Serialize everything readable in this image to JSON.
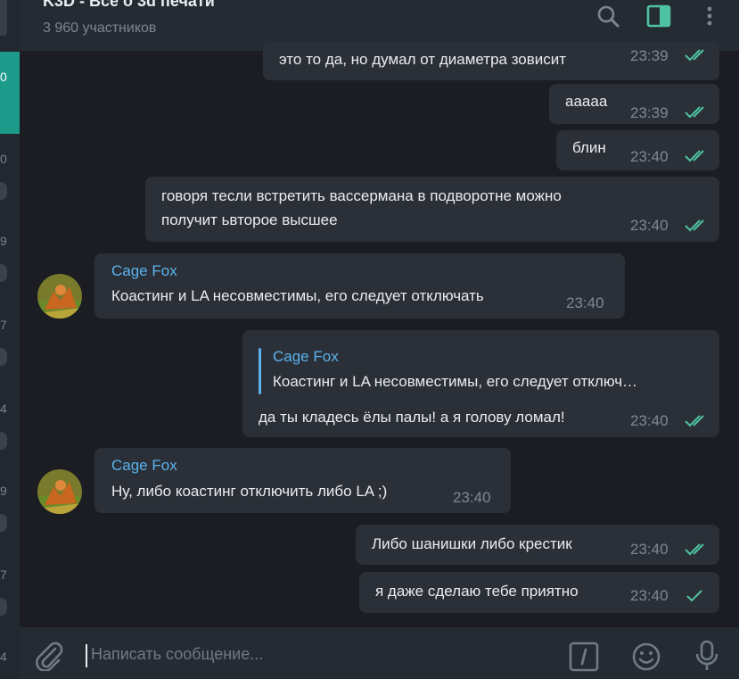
{
  "header": {
    "title": "K3D - Все о 3d печати",
    "subtitle": "3 960 участников",
    "icons": [
      "search-icon",
      "sidebar-toggle-icon",
      "more-icon"
    ]
  },
  "sidebar_fragment": {
    "active_label": "0",
    "numbers": [
      "0",
      "9",
      "7",
      "4",
      "9",
      "7",
      "4"
    ]
  },
  "messages": [
    {
      "text": "это то да, но думал от диаметра зовисит",
      "time": "23:39",
      "outgoing": true,
      "status": "read"
    },
    {
      "text": "ааааа",
      "time": "23:39",
      "outgoing": true,
      "status": "read"
    },
    {
      "text": "блин",
      "time": "23:40",
      "outgoing": true,
      "status": "read"
    },
    {
      "lines": [
        "говоря тесли встретить вассермана в подворотне можно",
        "получит ьвторое высшее"
      ],
      "time": "23:40",
      "outgoing": true,
      "status": "read"
    },
    {
      "sender": "Cage Fox",
      "text": "Коастинг и LA несовместимы, его следует отключать",
      "time": "23:40",
      "outgoing": false
    },
    {
      "reply_sender": "Cage Fox",
      "reply_text": "Коастинг и LA несовместимы, его следует отключ…",
      "text": "да ты кладесь ёлы палы! а я голову ломал!",
      "time": "23:40",
      "outgoing": true,
      "status": "read"
    },
    {
      "sender": "Cage Fox",
      "text": "Ну, либо коастинг отключить либо LA ;)",
      "time": "23:40",
      "outgoing": false
    },
    {
      "text": "Либо шанишки либо крестик",
      "time": "23:40",
      "outgoing": true,
      "status": "read"
    },
    {
      "text": "я даже сделаю тебе приятно",
      "time": "23:40",
      "outgoing": true,
      "status": "sent"
    }
  ],
  "composer": {
    "placeholder": "Написать сообщение...",
    "icons": [
      "attach-icon",
      "commands-icon",
      "emoji-icon",
      "microphone-icon"
    ]
  },
  "colors": {
    "accent": "#5ab3ee",
    "check": "#4fc3a1",
    "active_chat": "#1d9b8a",
    "bubble": "#2b3038",
    "background": "#1b1d22"
  }
}
